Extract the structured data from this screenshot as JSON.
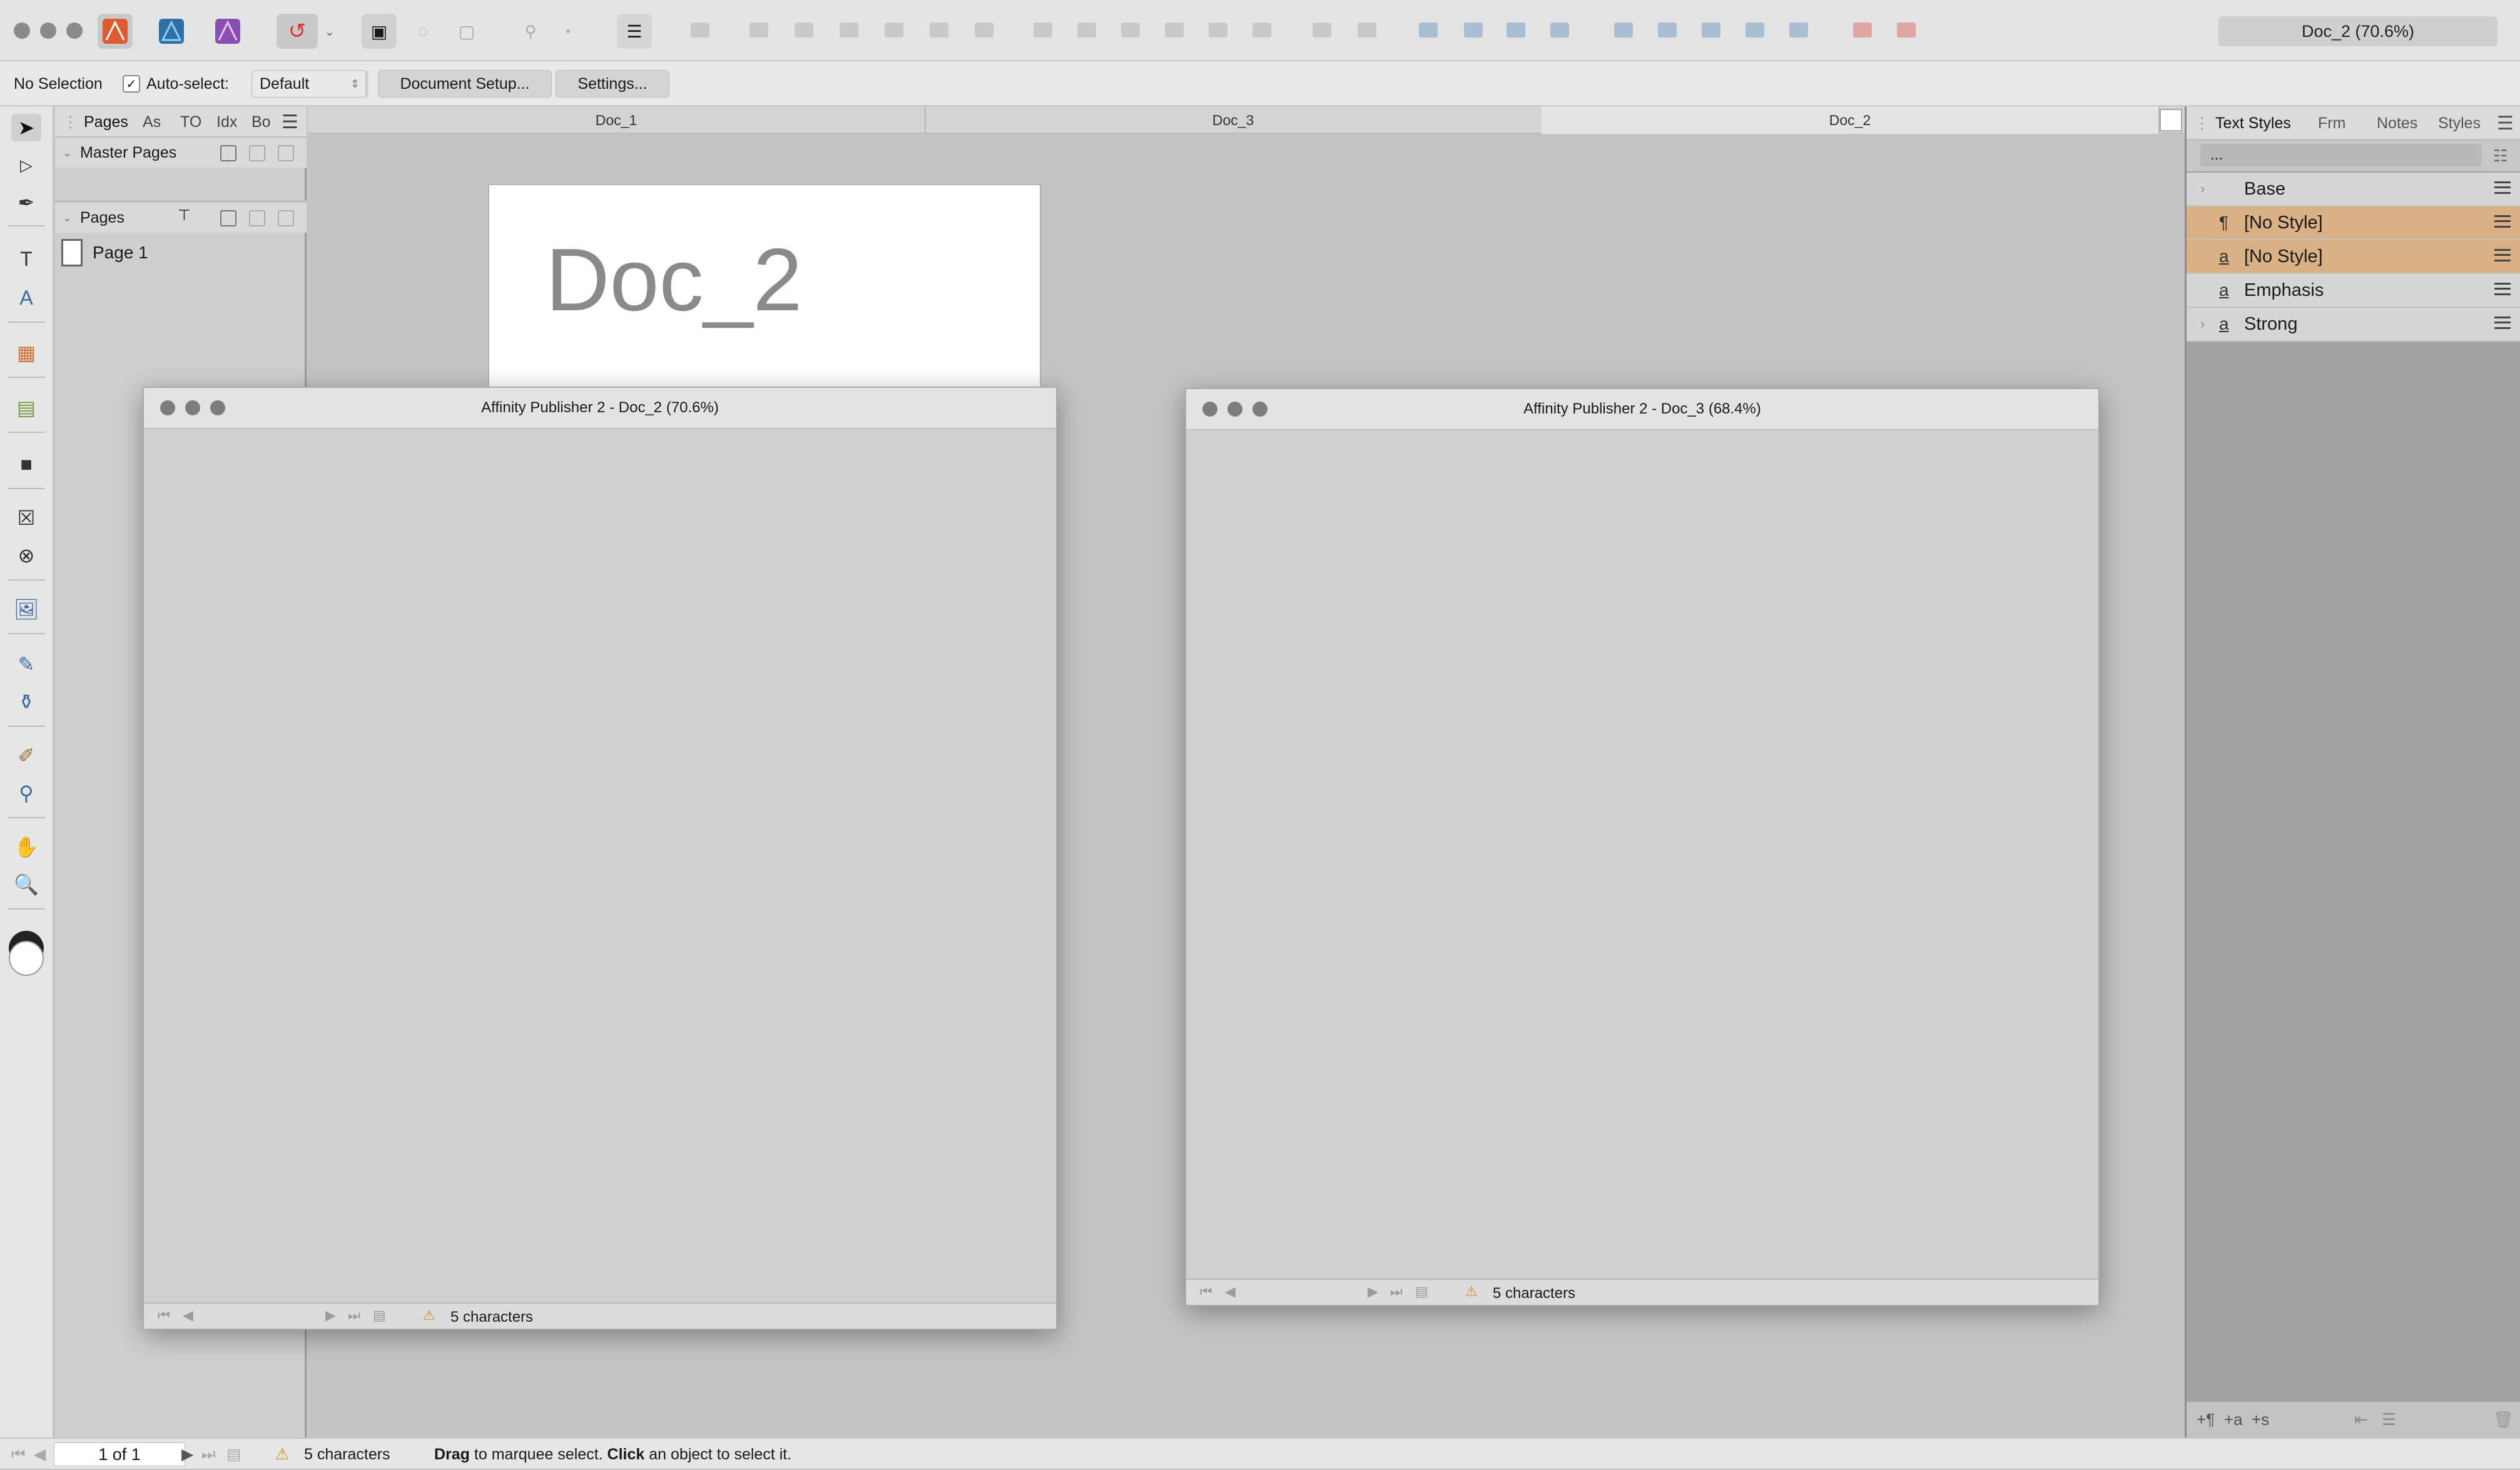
{
  "toolbar": {
    "doc_title": "Doc_2 (70.6%)",
    "app_icons": [
      "publisher-persona-icon",
      "designer-persona-icon",
      "photo-persona-icon"
    ]
  },
  "context": {
    "selection": "No Selection",
    "autoselect_label": "Auto-select:",
    "autoselect_checked": true,
    "autoselect_value": "Default",
    "document_setup": "Document Setup...",
    "settings": "Settings..."
  },
  "pages_panel": {
    "tabs": [
      "Pages",
      "As",
      "TO",
      "Idx",
      "Bo"
    ],
    "master_pages": "Master Pages",
    "pages": "Pages",
    "page_items": [
      "Page 1"
    ]
  },
  "doc_tabs": [
    "Doc_1",
    "Doc_3",
    "Doc_2"
  ],
  "canvas": {
    "page_text": "Doc_2"
  },
  "windows": [
    {
      "title": "Affinity Publisher 2 - Doc_2 (70.6%)",
      "status": "5 characters"
    },
    {
      "title": "Affinity Publisher 2 - Doc_3 (68.4%)",
      "status": "5 characters"
    }
  ],
  "right_panel": {
    "tabs": [
      "Text Styles",
      "Frm",
      "Notes",
      "Styles"
    ],
    "filter": "...",
    "styles": [
      {
        "label": "Base",
        "icon": "",
        "selected": false
      },
      {
        "label": "[No Style]",
        "icon": "¶",
        "selected": true
      },
      {
        "label": "[No Style]",
        "icon": "a",
        "selected": true
      },
      {
        "label": "Emphasis",
        "icon": "a",
        "selected": false
      },
      {
        "label": "Strong",
        "icon": "a",
        "selected": false
      }
    ],
    "selected_color": "#d9b184"
  },
  "status": {
    "page_of": "1 of 1",
    "characters": "5 characters",
    "hint_bold1": "Drag",
    "hint1": "to marquee select.",
    "hint_bold2": "Click",
    "hint2": "an object to select it."
  }
}
